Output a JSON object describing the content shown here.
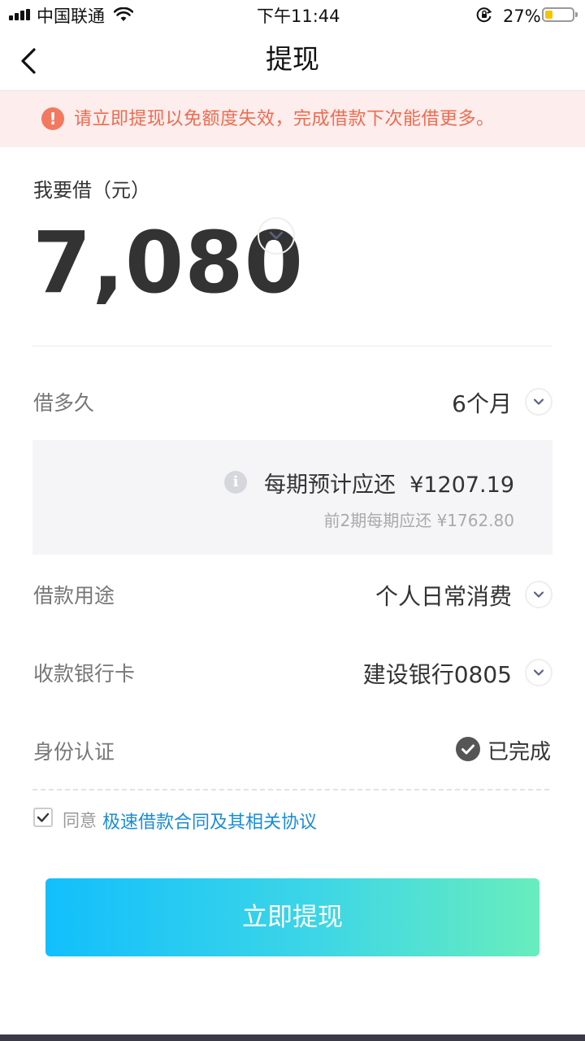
{
  "status_bar": {
    "carrier": "中国联通",
    "time": "下午11:44",
    "battery_percent": "27%",
    "battery_level": 0.27,
    "icons": [
      "signal-icon",
      "wifi-icon",
      "rotation-lock-icon",
      "battery-icon"
    ]
  },
  "nav": {
    "title": "提现",
    "back_icon": "chevron-left-icon"
  },
  "notice": {
    "icon": "alert-icon",
    "icon_glyph": "!",
    "text": "请立即提现以免额度失效，完成借款下次能借更多。"
  },
  "amount": {
    "label": "我要借（元）",
    "value": "7,080"
  },
  "term": {
    "label": "借多久",
    "value": "6个月"
  },
  "repayment": {
    "info_glyph": "i",
    "main": "每期预计应还  ¥1207.19",
    "sub": "前2期每期应还 ¥1762.80"
  },
  "purpose": {
    "label": "借款用途",
    "value": "个人日常消费"
  },
  "bank_card": {
    "label": "收款银行卡",
    "value": "建设银行0805"
  },
  "identity": {
    "label": "身份认证",
    "value": "已完成"
  },
  "agreement": {
    "checked": true,
    "prefix": "同意",
    "link": "极速借款合同及其相关协议"
  },
  "cta": {
    "label": "立即提现"
  },
  "colors": {
    "notice_bg": "#fdeeed",
    "notice_text": "#f06a4f",
    "link": "#1a8cd8",
    "cta_start": "#12bffc",
    "cta_end": "#68edbd"
  }
}
